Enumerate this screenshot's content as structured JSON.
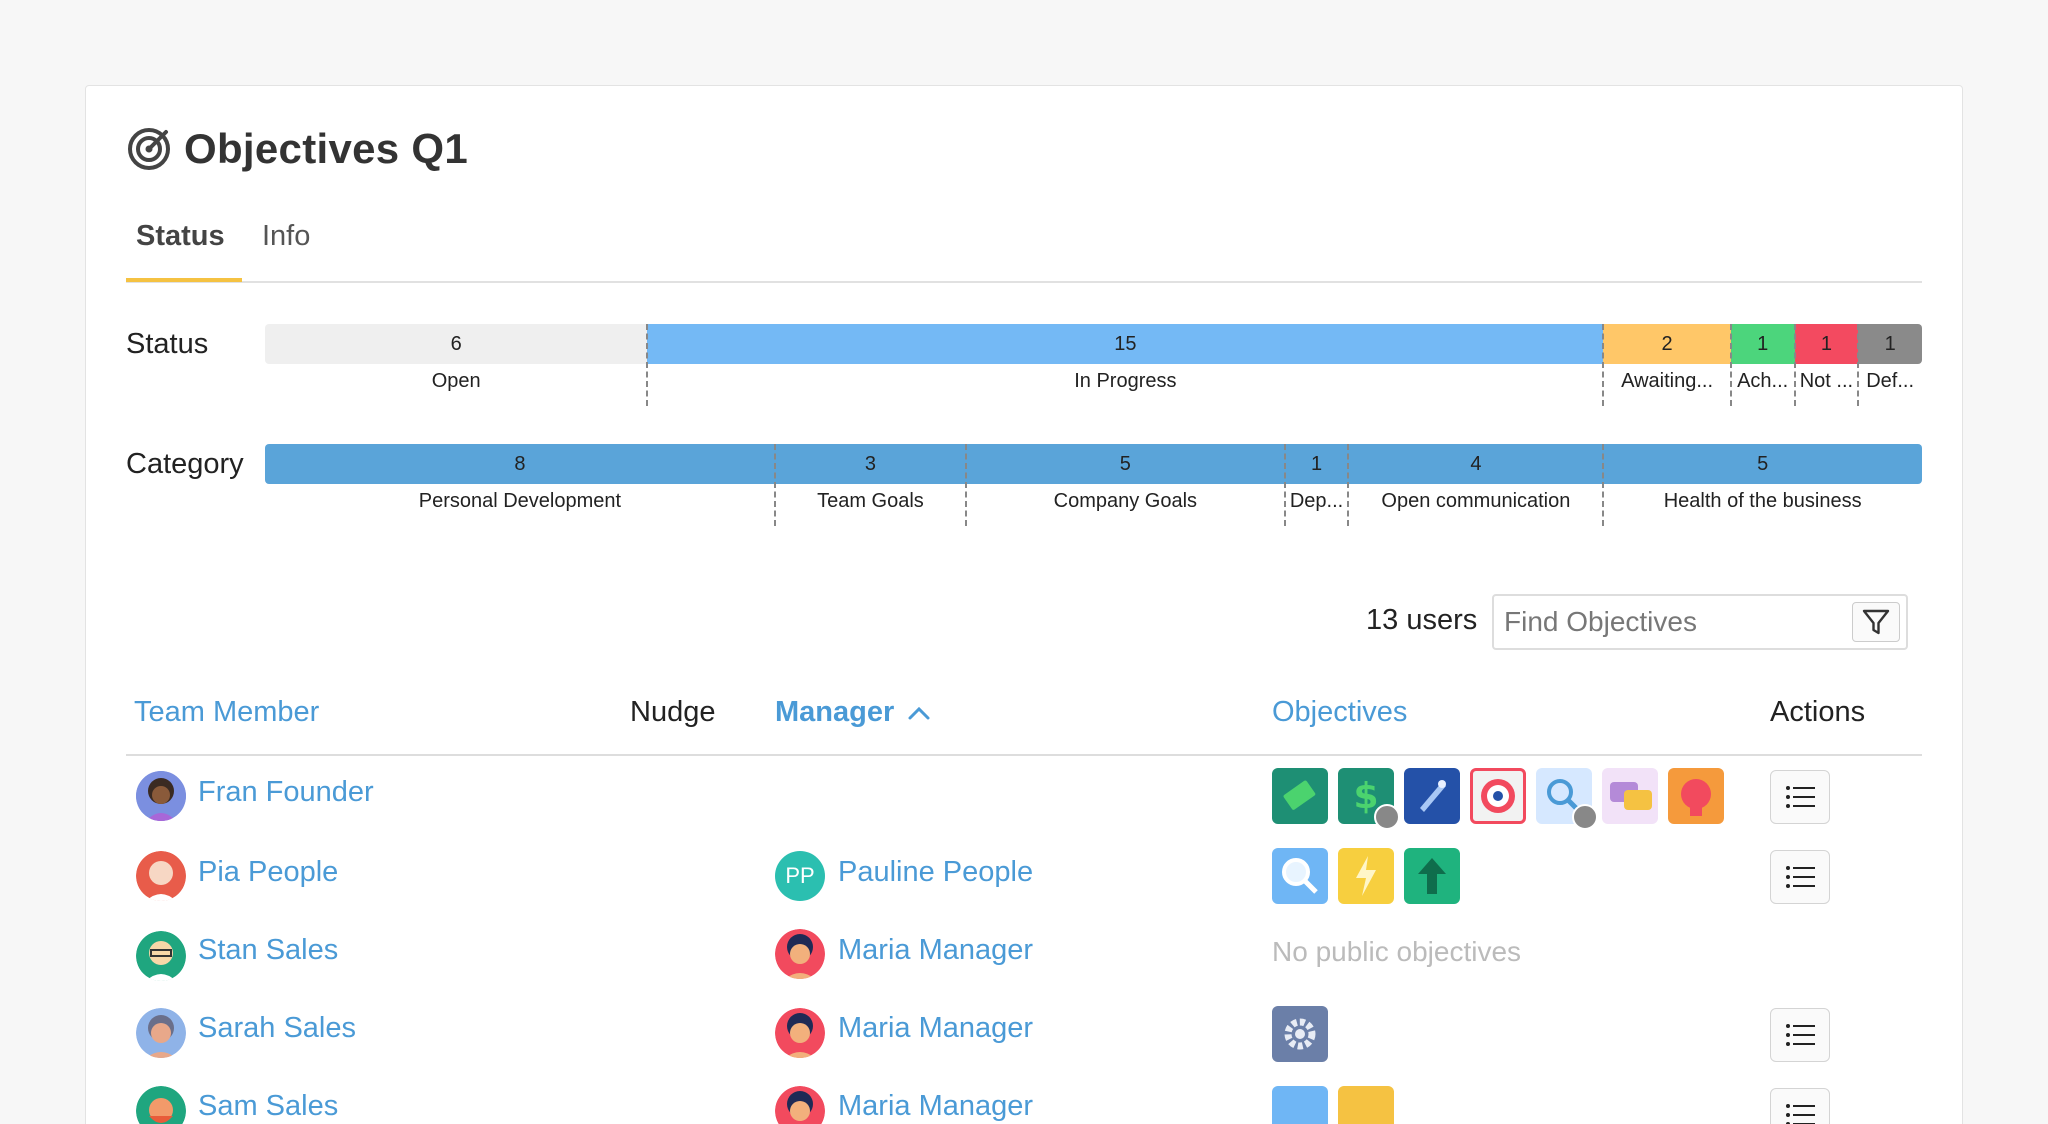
{
  "title": "Objectives Q1",
  "tabs": [
    {
      "label": "Status"
    },
    {
      "label": "Info"
    }
  ],
  "status_row": {
    "label": "Status",
    "segments": [
      {
        "label": "Open",
        "count": "6",
        "value": 6,
        "color": "#efefef"
      },
      {
        "label": "In Progress",
        "count": "15",
        "value": 15,
        "color": "#74b9f5"
      },
      {
        "label": "Awaiting...",
        "count": "2",
        "value": 2,
        "color": "#ffc768"
      },
      {
        "label": "Ach...",
        "count": "1",
        "value": 1,
        "color": "#4cd57c"
      },
      {
        "label": "Not ...",
        "count": "1",
        "value": 1,
        "color": "#f34a60"
      },
      {
        "label": "Def...",
        "count": "1",
        "value": 1,
        "color": "#8a8a8a"
      }
    ]
  },
  "category_row": {
    "label": "Category",
    "segments": [
      {
        "label": "Personal Development",
        "count": "8",
        "value": 8,
        "color": "#5aa4d9"
      },
      {
        "label": "Team Goals",
        "count": "3",
        "value": 3,
        "color": "#5aa4d9"
      },
      {
        "label": "Company Goals",
        "count": "5",
        "value": 5,
        "color": "#5aa4d9"
      },
      {
        "label": "Dep...",
        "count": "1",
        "value": 1,
        "color": "#5aa4d9"
      },
      {
        "label": "Open communication",
        "count": "4",
        "value": 4,
        "color": "#5aa4d9"
      },
      {
        "label": "Health of the business",
        "count": "5",
        "value": 5,
        "color": "#5aa4d9"
      }
    ]
  },
  "toolbar": {
    "users_count": "13 users",
    "search_placeholder": "Find Objectives"
  },
  "table": {
    "headers": {
      "team_member": "Team Member",
      "nudge": "Nudge",
      "manager": "Manager",
      "objectives": "Objectives",
      "actions": "Actions"
    },
    "rows": [
      {
        "member": "Fran Founder",
        "manager": "",
        "manager_initials": "",
        "no_objectives": "",
        "has_actions": true
      },
      {
        "member": "Pia People",
        "manager": "Pauline People",
        "manager_initials": "PP",
        "no_objectives": "",
        "has_actions": true
      },
      {
        "member": "Stan Sales",
        "manager": "Maria Manager",
        "manager_initials": "",
        "no_objectives": "No public objectives",
        "has_actions": false
      },
      {
        "member": "Sarah Sales",
        "manager": "Maria Manager",
        "manager_initials": "",
        "no_objectives": "",
        "has_actions": true
      },
      {
        "member": "Sam Sales",
        "manager": "Maria Manager",
        "manager_initials": "",
        "no_objectives": "",
        "has_actions": true
      }
    ]
  },
  "icons": {
    "title": "target-icon",
    "filter": "filter-funnel-icon",
    "sort": "chevron-up-icon",
    "actions": "list-icon"
  }
}
